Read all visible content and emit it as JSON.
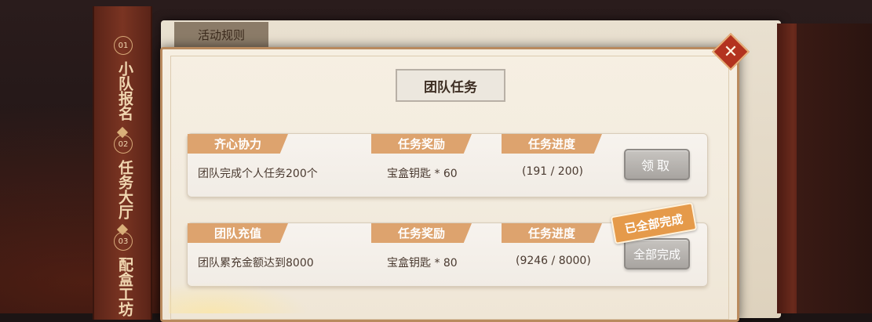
{
  "side_tabs": [
    {
      "number": "01",
      "label": "小队报名"
    },
    {
      "number": "02",
      "label": "任务大厅"
    },
    {
      "number": "03",
      "label": "配盒工坊"
    }
  ],
  "rules_tab": "活动规则",
  "dialog": {
    "title": "团队任务",
    "close_icon": "close-icon"
  },
  "column_labels": {
    "reward": "任务奖励",
    "progress": "任务进度"
  },
  "tasks": [
    {
      "name": "齐心协力",
      "description": "团队完成个人任务200个",
      "reward": "宝盒钥匙 * 60",
      "progress_text": "(191 / 200)",
      "button": "领取",
      "status_badge": ""
    },
    {
      "name": "团队充值",
      "description": "团队累充金额达到8000",
      "reward": "宝盒钥匙 * 80",
      "progress_text": "(9246 / 8000)",
      "button": "全部完成",
      "status_badge": "已全部完成"
    }
  ],
  "colors": {
    "accent": "#dda36e",
    "close": "#b3331f",
    "button_gray": "#b5b1ad"
  }
}
